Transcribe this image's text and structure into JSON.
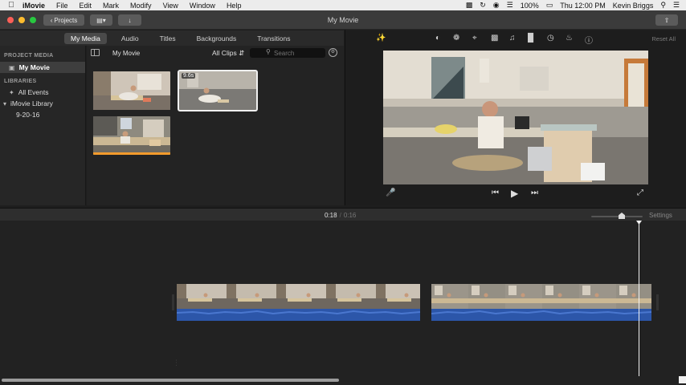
{
  "menubar": {
    "apple": "",
    "items": [
      "iMovie",
      "File",
      "Edit",
      "Mark",
      "Modify",
      "View",
      "Window",
      "Help"
    ],
    "battery": "100%",
    "clock": "Thu 12:00 PM",
    "user": "Kevin Briggs"
  },
  "toolbar": {
    "projects_label": "Projects",
    "window_title": "My Movie"
  },
  "tabs": [
    "My Media",
    "Audio",
    "Titles",
    "Backgrounds",
    "Transitions"
  ],
  "sidebar": {
    "project_media_heading": "PROJECT MEDIA",
    "project_item": "My Movie",
    "libraries_heading": "LIBRARIES",
    "all_events": "All Events",
    "library": "iMovie Library",
    "event": "9-20-16"
  },
  "browser": {
    "title": "My Movie",
    "filter": "All Clips",
    "search_placeholder": "Search",
    "selected_clip_duration": "9.6s"
  },
  "viewer": {
    "reset_all": "Reset All"
  },
  "timeline": {
    "current_time": "0:18",
    "total_time": "0:16",
    "settings": "Settings"
  },
  "colors": {
    "selection_outline": "#f0f0f0",
    "used_range": "#f29b2c",
    "audio_wave": "#2c56a9"
  }
}
